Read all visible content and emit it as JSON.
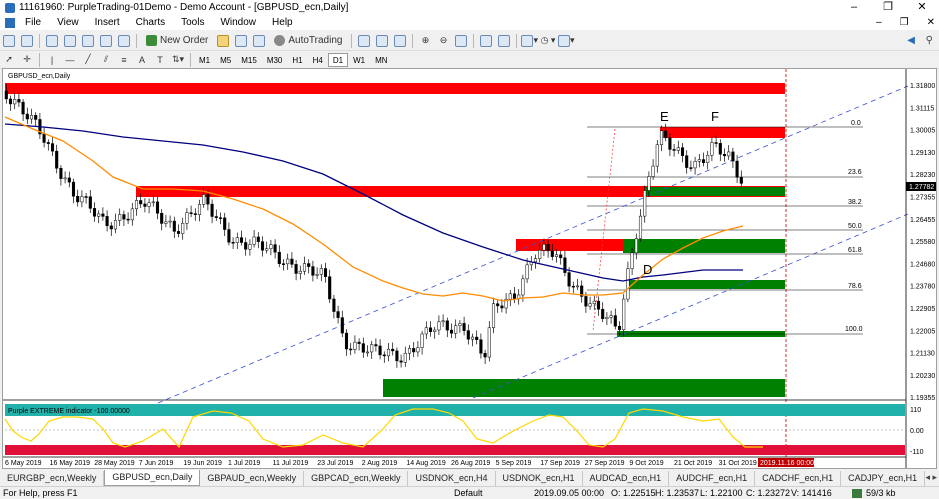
{
  "window": {
    "title": "11161960: PurpleTrading-01Demo - Demo Account - [GBPUSD_ecn,Daily]",
    "controls": [
      "–",
      "❐",
      "✕"
    ]
  },
  "menu": {
    "items": [
      "File",
      "View",
      "Insert",
      "Charts",
      "Tools",
      "Window",
      "Help"
    ],
    "mdi": [
      "–",
      "❐",
      "✕"
    ]
  },
  "toolbar": {
    "new_order": "New Order",
    "autotrading": "AutoTrading",
    "timeframes": [
      "M1",
      "M5",
      "M15",
      "M30",
      "H1",
      "H4",
      "D1",
      "W1",
      "MN"
    ],
    "active_timeframe": "D1"
  },
  "chart": {
    "label": "GBPUSD_ecn,Daily",
    "price_labels": [
      "1.31800",
      "1.31115",
      "1.30005",
      "1.29130",
      "1.28230",
      "1.27355",
      "1.26455",
      "1.25580",
      "1.24680",
      "1.23780",
      "1.22905",
      "1.22005",
      "1.21130",
      "1.20230",
      "1.19355"
    ],
    "current_price": "1.27782",
    "fib_levels": [
      "0.0",
      "23.6",
      "38.2",
      "50.0",
      "61.8",
      "78.6",
      "100.0"
    ],
    "letters": [
      "E",
      "F",
      "D"
    ],
    "date_labels": [
      "6 May 2019",
      "16 May 2019",
      "28 May 2019",
      "7 Jun 2019",
      "19 Jun 2019",
      "1 Jul 2019",
      "11 Jul 2019",
      "23 Jul 2019",
      "2 Aug 2019",
      "14 Aug 2019",
      "26 Aug 2019",
      "5 Sep 2019",
      "17 Sep 2019",
      "27 Sep 2019",
      "9 Oct 2019",
      "21 Oct 2019",
      "31 Oct 2019"
    ],
    "end_date": "2019.11.16 00:00",
    "colors": {
      "supply": "#ff0000",
      "demand": "#008000",
      "ma_slow": "#00007f",
      "ma_fast": "#ff8c00",
      "channel": "#3a4fd0",
      "current_price_bg": "#000000"
    }
  },
  "indicator": {
    "label": "Purple EXTREME indicator -100.00000",
    "scale": [
      "110",
      "0.00",
      "-110"
    ],
    "colors": {
      "top_band": "#20b2aa",
      "bottom_band": "#e0103a",
      "line": "#ffd700"
    }
  },
  "tabs": {
    "items": [
      "EURGBP_ecn,Weekly",
      "GBPUSD_ecn,Daily",
      "GBPAUD_ecn,Weekly",
      "GBPCAD_ecn,Weekly",
      "USDNOK_ecn,H4",
      "USDNOK_ecn,H1",
      "AUDCAD_ecn,H1",
      "AUDCHF_ecn,H1",
      "CADCHF_ecn,H1",
      "CADJPY_ecn,H1"
    ],
    "active": "GBPUSD_ecn,Daily"
  },
  "status": {
    "help": "For Help, press F1",
    "profile": "Default",
    "datetime": "2019.09.05 00:00",
    "open": "O: 1.22515",
    "high": "H: 1.23537",
    "low": "L: 1.22100",
    "close": "C: 1.23272",
    "volume": "V: 141416",
    "traffic": "59/3 kb"
  }
}
